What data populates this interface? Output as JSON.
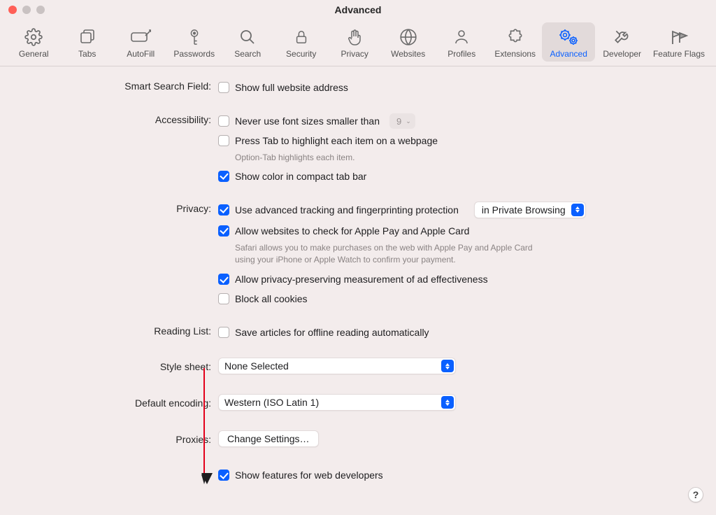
{
  "window": {
    "title": "Advanced"
  },
  "toolbar": {
    "items": [
      {
        "id": "general",
        "label": "General"
      },
      {
        "id": "tabs",
        "label": "Tabs"
      },
      {
        "id": "autofill",
        "label": "AutoFill"
      },
      {
        "id": "passwords",
        "label": "Passwords"
      },
      {
        "id": "search",
        "label": "Search"
      },
      {
        "id": "security",
        "label": "Security"
      },
      {
        "id": "privacy",
        "label": "Privacy"
      },
      {
        "id": "websites",
        "label": "Websites"
      },
      {
        "id": "profiles",
        "label": "Profiles"
      },
      {
        "id": "extensions",
        "label": "Extensions"
      },
      {
        "id": "advanced",
        "label": "Advanced"
      },
      {
        "id": "developer",
        "label": "Developer"
      },
      {
        "id": "featureflags",
        "label": "Feature Flags"
      }
    ],
    "active": "advanced"
  },
  "sections": {
    "smartSearch": {
      "label": "Smart Search Field:",
      "showFullAddress": "Show full website address"
    },
    "accessibility": {
      "label": "Accessibility:",
      "minFont": "Never use font sizes smaller than",
      "minFontValue": "9",
      "pressTab": "Press Tab to highlight each item on a webpage",
      "pressTabHint": "Option-Tab highlights each item.",
      "compactColor": "Show color in compact tab bar"
    },
    "privacy": {
      "label": "Privacy:",
      "advTracking": "Use advanced tracking and fingerprinting protection",
      "trackingScope": "in Private Browsing",
      "applePay": "Allow websites to check for Apple Pay and Apple Card",
      "applePayHint": "Safari allows you to make purchases on the web with Apple Pay and Apple Card using your iPhone or Apple Watch to confirm your payment.",
      "adMeasure": "Allow privacy-preserving measurement of ad effectiveness",
      "blockCookies": "Block all cookies"
    },
    "readingList": {
      "label": "Reading List:",
      "saveOffline": "Save articles for offline reading automatically"
    },
    "styleSheet": {
      "label": "Style sheet:",
      "value": "None Selected"
    },
    "encoding": {
      "label": "Default encoding:",
      "value": "Western (ISO Latin 1)"
    },
    "proxies": {
      "label": "Proxies:",
      "button": "Change Settings…"
    },
    "devFeatures": {
      "label": "Show features for web developers"
    }
  },
  "help": "?"
}
